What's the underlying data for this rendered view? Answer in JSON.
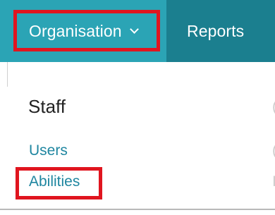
{
  "navbar": {
    "items": [
      {
        "label": "Organisation"
      },
      {
        "label": "Reports"
      }
    ]
  },
  "dropdown": {
    "heading": "Staff",
    "links": [
      {
        "label": "Users"
      },
      {
        "label": "Abilities"
      }
    ]
  },
  "colors": {
    "navbar_bg": "#1b7f8f",
    "active_item_bg": "#2ba4b5",
    "link": "#1f86a0",
    "highlight_border": "#e0151f"
  },
  "icons": {
    "organisation_dropdown": "chevron-down-icon"
  }
}
